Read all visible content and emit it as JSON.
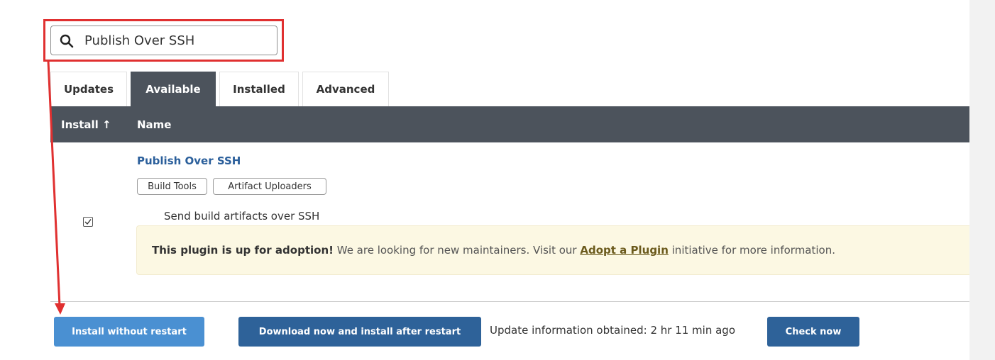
{
  "search": {
    "value": "Publish Over SSH"
  },
  "tabs": [
    {
      "label": "Updates"
    },
    {
      "label": "Available"
    },
    {
      "label": "Installed"
    },
    {
      "label": "Advanced"
    }
  ],
  "table": {
    "columns": {
      "install": "Install ↑",
      "name": "Name"
    },
    "plugin": {
      "name": "Publish Over SSH",
      "tags": [
        "Build Tools",
        "Artifact Uploaders"
      ],
      "checked": true,
      "description": "Send build artifacts over SSH",
      "adoption": {
        "strong": "This plugin is up for adoption!",
        "text_before": " We are looking for new maintainers. Visit our ",
        "link": "Adopt a Plugin",
        "text_after": " initiative for more information."
      }
    }
  },
  "footer": {
    "install_button": "Install without restart",
    "download_button": "Download now and install after restart",
    "update_info": "Update information obtained: 2 hr 11 min ago",
    "check_button": "Check now"
  },
  "colors": {
    "annotation": "#e03030",
    "header_bg": "#4c535c",
    "link": "#2b5f9b",
    "adoption_bg": "#fcf8e3"
  },
  "icons": {
    "search": "search-icon",
    "checkbox": "checkmark-icon",
    "annotation_arrow": "red-arrow-icon"
  }
}
